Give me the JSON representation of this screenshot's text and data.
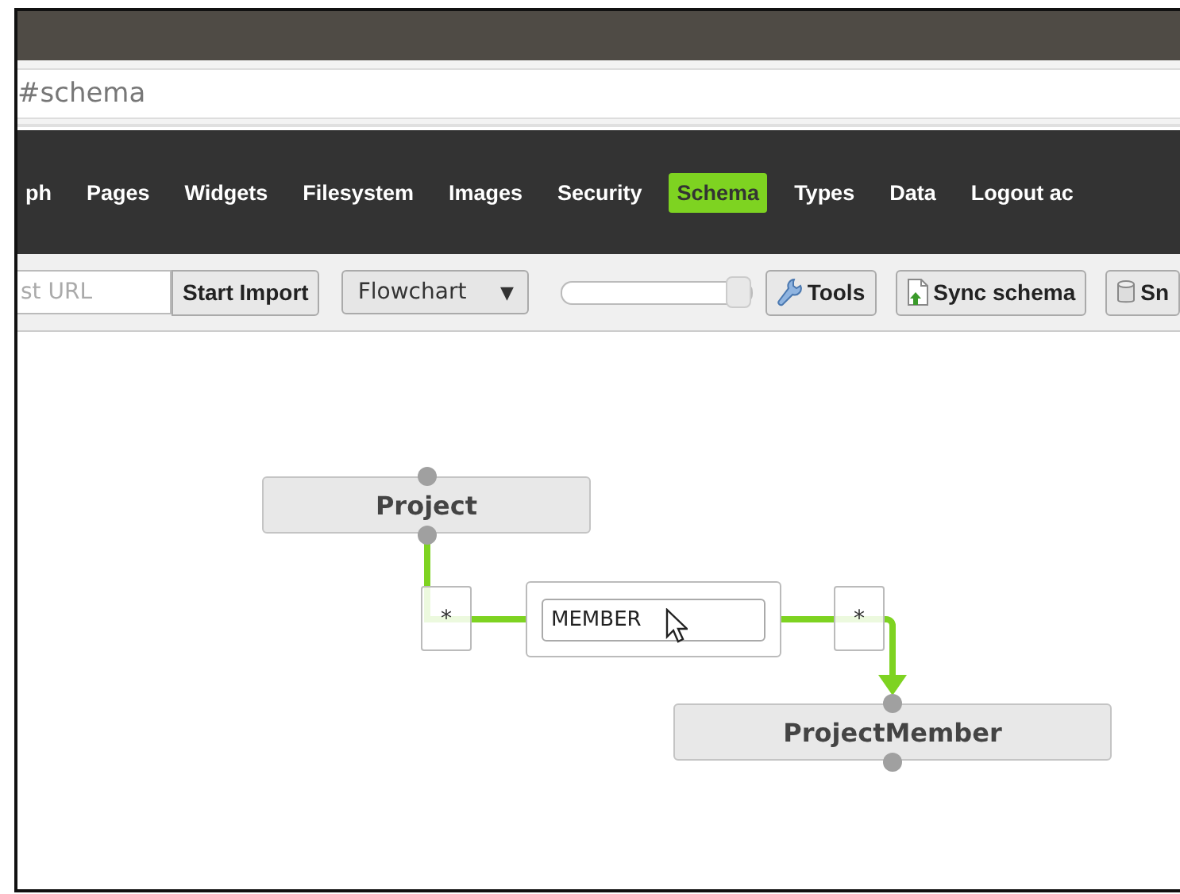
{
  "window": {
    "address": "#schema"
  },
  "nav": {
    "items": [
      {
        "label": "ph",
        "selected": false
      },
      {
        "label": "Pages",
        "selected": false
      },
      {
        "label": "Widgets",
        "selected": false
      },
      {
        "label": "Filesystem",
        "selected": false
      },
      {
        "label": "Images",
        "selected": false
      },
      {
        "label": "Security",
        "selected": false
      },
      {
        "label": "Schema",
        "selected": true
      },
      {
        "label": "Types",
        "selected": false
      },
      {
        "label": "Data",
        "selected": false
      },
      {
        "label": "Logout ac",
        "selected": false
      }
    ]
  },
  "toolbar": {
    "url_field": {
      "placeholder": "st URL"
    },
    "import_button": "Start Import",
    "layout_select": {
      "value": "Flowchart",
      "caret": "▼"
    },
    "slider": {
      "level": 1
    },
    "buttons": [
      {
        "label": "Tools"
      },
      {
        "label": "Sync schema"
      },
      {
        "label": "Sn"
      }
    ]
  },
  "schema": {
    "nodes": [
      {
        "name": "Project"
      },
      {
        "name": "ProjectMember"
      }
    ],
    "relationship": {
      "source_multiplicity": "*",
      "name": "MEMBER",
      "target_multiplicity": "*"
    }
  }
}
